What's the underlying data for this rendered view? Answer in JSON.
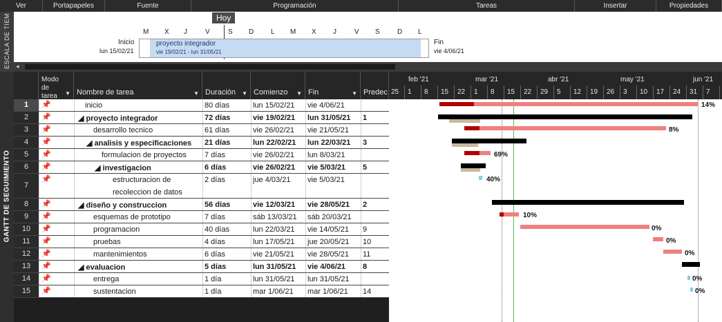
{
  "ribbon": {
    "items": [
      "Ver",
      "Portapapeles",
      "Fuente",
      "Programación",
      "Tareas",
      "Insertar",
      "Propiedades"
    ]
  },
  "timeline": {
    "side_label": "ESCALA DE TIEM",
    "today": "Hoy",
    "start_label": "Inicio",
    "start_date": "lun 15/02/21",
    "end_label": "Fin",
    "end_date": "vie 4/06/21",
    "project_name": "proyecto integrador",
    "project_dates": "vie 19/02/21 - lun 31/05/21",
    "ticks": [
      "M",
      "X",
      "J",
      "V",
      "S",
      "D",
      "L",
      "M",
      "X",
      "J",
      "V",
      "S",
      "D",
      "L"
    ]
  },
  "gantt": {
    "side_label": "GANTT DE SEGUIMIENTO",
    "columns": {
      "mode": "Modo de tarea",
      "name": "Nombre de tarea",
      "duration": "Duración",
      "start": "Comienzo",
      "finish": "Fin",
      "pred": "Predec"
    },
    "rows": [
      {
        "id": "1",
        "name": "inicio",
        "duration": "80 días",
        "start": "lun 15/02/21",
        "finish": "vie 4/06/21",
        "pred": ""
      },
      {
        "id": "2",
        "name": "◢ proyecto integrador",
        "duration": "72 días",
        "start": "vie 19/02/21",
        "finish": "lun 31/05/21",
        "pred": "1"
      },
      {
        "id": "3",
        "name": "desarrollo tecnico",
        "duration": "61 días",
        "start": "vie 26/02/21",
        "finish": "vie 21/05/21",
        "pred": ""
      },
      {
        "id": "4",
        "name": "◢ analisis y especificaciones",
        "duration": "21 días",
        "start": "lun 22/02/21",
        "finish": "lun 22/03/21",
        "pred": "3"
      },
      {
        "id": "5",
        "name": "formulacion de proyectos",
        "duration": "7 días",
        "start": "vie 26/02/21",
        "finish": "lun 8/03/21",
        "pred": ""
      },
      {
        "id": "6",
        "name": "◢ investigacion",
        "duration": "6 días",
        "start": "vie 26/02/21",
        "finish": "vie 5/03/21",
        "pred": "5"
      },
      {
        "id": "7",
        "name": "estructuracion de",
        "name2": "recoleccion de datos",
        "duration": "2 días",
        "start": "jue 4/03/21",
        "finish": "vie 5/03/21",
        "pred": ""
      },
      {
        "id": "8",
        "name": "◢ diseño y construccion",
        "duration": "56 días",
        "start": "vie 12/03/21",
        "finish": "vie 28/05/21",
        "pred": "2"
      },
      {
        "id": "9",
        "name": "esquemas de prototipo",
        "duration": "7 días",
        "start": "sáb 13/03/21",
        "finish": "sáb 20/03/21",
        "pred": ""
      },
      {
        "id": "10",
        "name": "programacion",
        "duration": "40 días",
        "start": "lun 22/03/21",
        "finish": "vie 14/05/21",
        "pred": "9"
      },
      {
        "id": "11",
        "name": "pruebas",
        "duration": "4 días",
        "start": "lun 17/05/21",
        "finish": "jue 20/05/21",
        "pred": "10"
      },
      {
        "id": "12",
        "name": "mantenimientos",
        "duration": "6 días",
        "start": "vie 21/05/21",
        "finish": "vie 28/05/21",
        "pred": "11"
      },
      {
        "id": "13",
        "name": "◢ evaluacion",
        "duration": "5 días",
        "start": "lun 31/05/21",
        "finish": "vie 4/06/21",
        "pred": "8"
      },
      {
        "id": "14",
        "name": "entrega",
        "duration": "1 día",
        "start": "lun 31/05/21",
        "finish": "lun 31/05/21",
        "pred": ""
      },
      {
        "id": "15",
        "name": "sustentacion",
        "duration": "1 día",
        "start": "mar 1/06/21",
        "finish": "mar 1/06/21",
        "pred": "14"
      }
    ]
  },
  "chart": {
    "months": [
      "feb '21",
      "mar '21",
      "abr '21",
      "may '21",
      "jun '21"
    ],
    "days": [
      "25",
      "1",
      "8",
      "15",
      "22",
      "1",
      "8",
      "15",
      "22",
      "29",
      "5",
      "12",
      "19",
      "26",
      "3",
      "10",
      "17",
      "24",
      "31",
      "7"
    ],
    "percents": [
      "14%",
      "8%",
      "69%",
      "40%",
      "10%",
      "0%",
      "0%",
      "0%",
      "0%",
      "0%"
    ]
  }
}
